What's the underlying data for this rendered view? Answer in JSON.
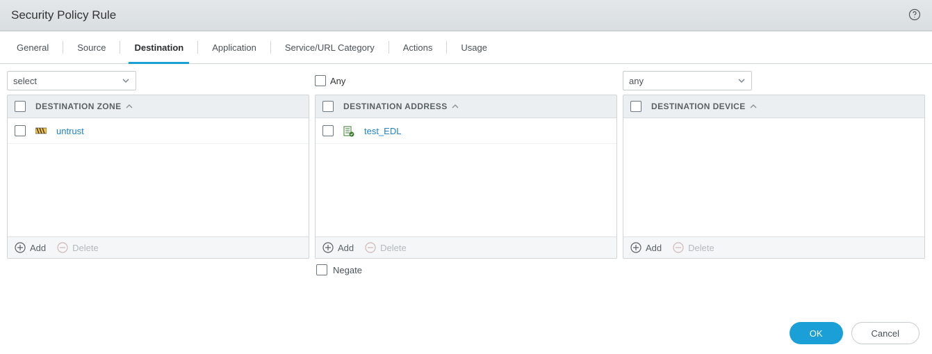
{
  "title": "Security Policy Rule",
  "tabs": [
    "General",
    "Source",
    "Destination",
    "Application",
    "Service/URL Category",
    "Actions",
    "Usage"
  ],
  "active_tab": "Destination",
  "panels": {
    "zone": {
      "select_value": "select",
      "header": "DESTINATION ZONE",
      "rows": [
        {
          "icon": "zone-icon",
          "label": "untrust"
        }
      ],
      "add_label": "Add",
      "delete_label": "Delete"
    },
    "address": {
      "any_label": "Any",
      "header": "DESTINATION ADDRESS",
      "rows": [
        {
          "icon": "edl-icon",
          "label": "test_EDL"
        }
      ],
      "add_label": "Add",
      "delete_label": "Delete",
      "negate_label": "Negate"
    },
    "device": {
      "select_value": "any",
      "header": "DESTINATION DEVICE",
      "rows": [],
      "add_label": "Add",
      "delete_label": "Delete"
    }
  },
  "buttons": {
    "ok": "OK",
    "cancel": "Cancel"
  }
}
